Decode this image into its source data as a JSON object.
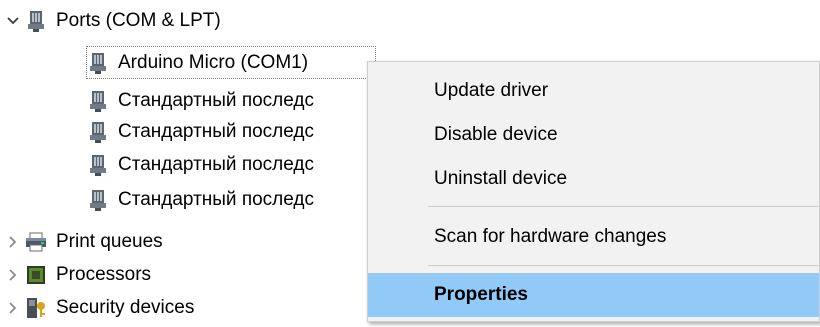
{
  "tree": {
    "ports": "Ports (COM & LPT)",
    "children": [
      "Arduino Micro (COM1)",
      "Стандартный последс",
      "Стандартный последс",
      "Стандартный последс",
      "Стандартный последс"
    ],
    "print_queues": "Print queues",
    "processors": "Processors",
    "security_devices": "Security devices"
  },
  "context_menu": {
    "items": [
      "Update driver",
      "Disable device",
      "Uninstall device",
      "Scan for hardware changes",
      "Properties"
    ],
    "highlighted_item": "Properties",
    "highlight_color": "#91c9f7"
  },
  "icons": {
    "expanded": "chevron-down-icon",
    "collapsed": "chevron-right-icon",
    "port": "port-connector-icon",
    "printer": "printer-icon",
    "processor": "processor-chip-icon",
    "security": "security-key-icon"
  }
}
